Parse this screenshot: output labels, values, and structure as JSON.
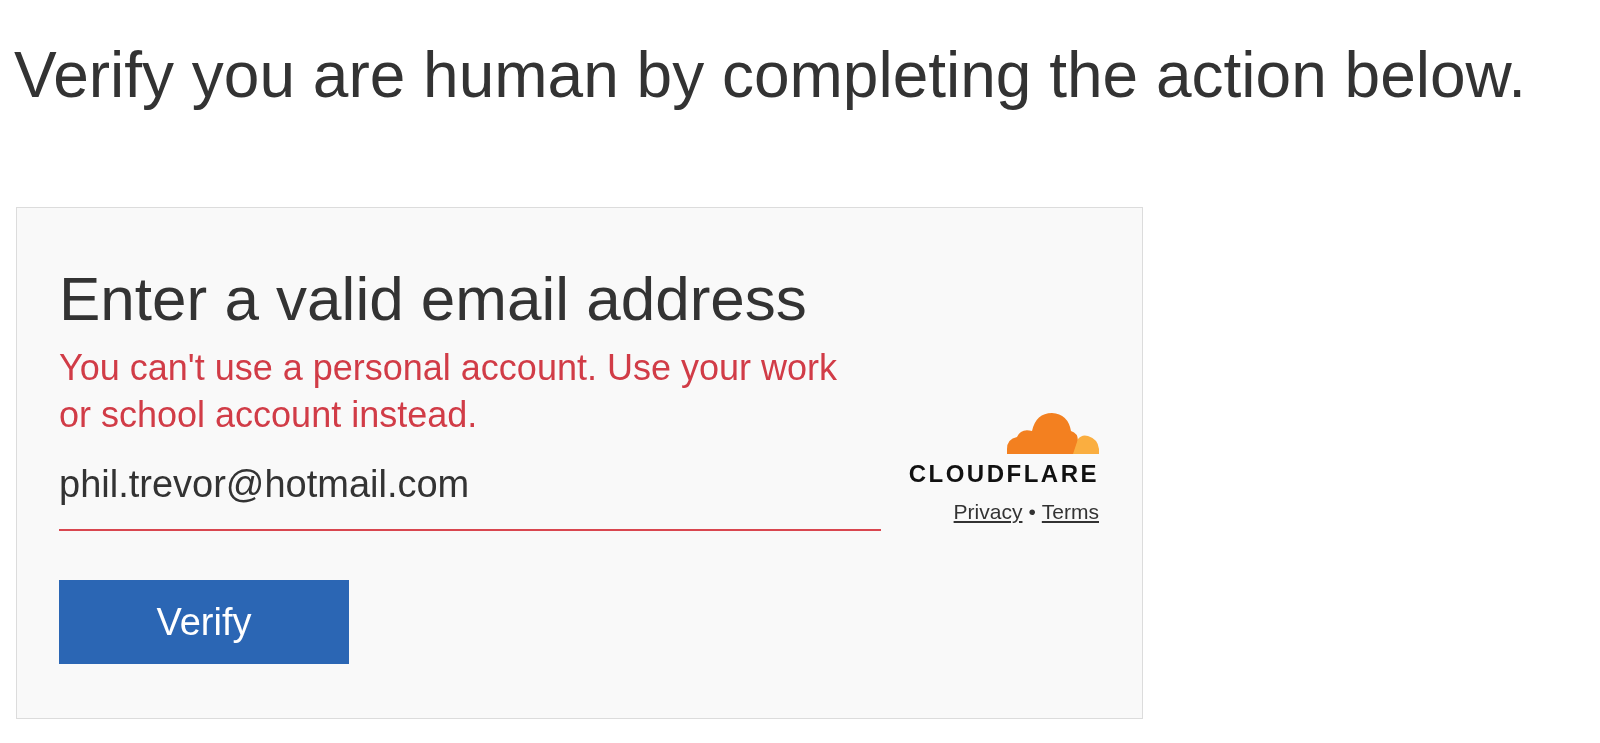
{
  "page": {
    "heading": "Verify you are human by completing the action below."
  },
  "form": {
    "title": "Enter a valid email address",
    "error": "You can't use a personal account. Use your work or school account instead.",
    "email": {
      "value": "phil.trevor@hotmail.com",
      "invalid": true
    },
    "button": "Verify"
  },
  "branding": {
    "logo_text": "CLOUDFLARE",
    "links": [
      {
        "label": "Privacy"
      },
      {
        "label": "Terms"
      }
    ],
    "separator": "•"
  }
}
